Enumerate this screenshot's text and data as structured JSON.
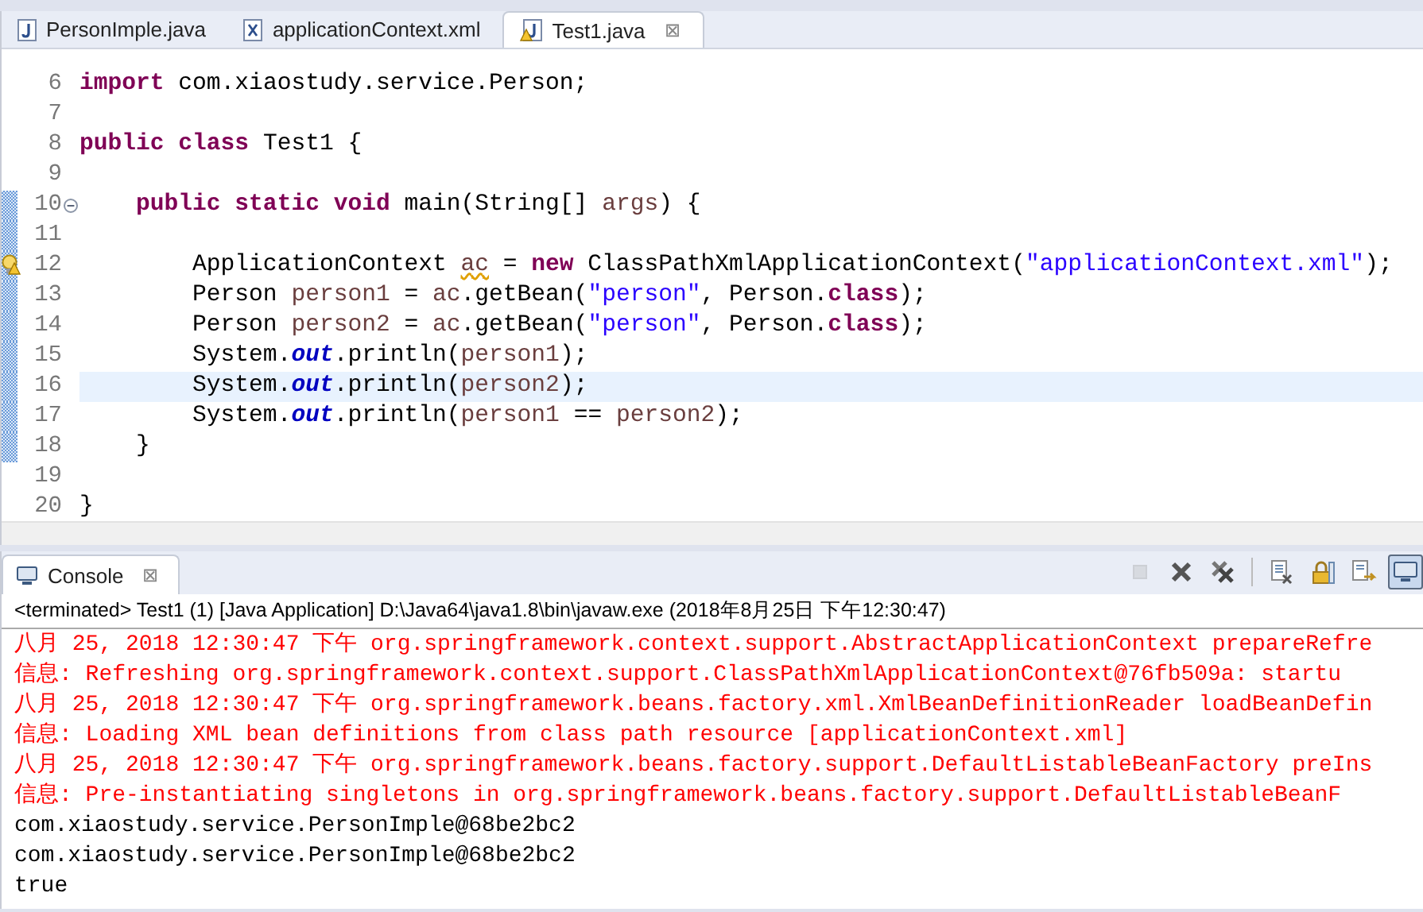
{
  "editor_tabs": [
    {
      "label": "PersonImple.java",
      "kind": "java",
      "selected": false,
      "warning": false
    },
    {
      "label": "applicationContext.xml",
      "kind": "xml",
      "selected": false,
      "warning": false
    },
    {
      "label": "Test1.java",
      "kind": "java",
      "selected": true,
      "warning": true,
      "close": "⊠"
    }
  ],
  "code_lines": [
    {
      "number": "6",
      "changed": false,
      "current": false,
      "warning": false,
      "fold": false,
      "tokens": [
        {
          "kind": "keyword",
          "text": "import"
        },
        {
          "kind": "plain",
          "text": " com.xiaostudy.service.Person;"
        }
      ]
    },
    {
      "number": "7",
      "changed": false,
      "current": false,
      "warning": false,
      "fold": false
    },
    {
      "number": "8",
      "changed": false,
      "current": false,
      "warning": false,
      "fold": false,
      "tokens": [
        {
          "kind": "keyword",
          "text": "public class"
        },
        {
          "kind": "plain",
          "text": " Test1 {"
        }
      ]
    },
    {
      "number": "9",
      "changed": false,
      "current": false,
      "warning": false,
      "fold": false
    },
    {
      "number": "10",
      "changed": true,
      "current": false,
      "warning": false,
      "fold": true,
      "tokens": [
        {
          "kind": "keyword",
          "text": "    public static void"
        },
        {
          "kind": "plain",
          "text": " main(String[] "
        },
        {
          "kind": "local",
          "text": "args"
        },
        {
          "kind": "plain",
          "text": ") {"
        }
      ]
    },
    {
      "number": "11",
      "changed": true,
      "current": false,
      "warning": false,
      "fold": false
    },
    {
      "number": "12",
      "changed": true,
      "current": false,
      "warning": true,
      "fold": false,
      "tokens": [
        {
          "kind": "plain",
          "text": "        ApplicationContext "
        },
        {
          "kind": "flagged",
          "text": "ac"
        },
        {
          "kind": "plain",
          "text": " = "
        },
        {
          "kind": "keyword",
          "text": "new"
        },
        {
          "kind": "plain",
          "text": " ClassPathXmlApplicationContext("
        },
        {
          "kind": "string",
          "text": "\"applicationContext.xml\""
        },
        {
          "kind": "plain",
          "text": ");"
        }
      ]
    },
    {
      "number": "13",
      "changed": true,
      "current": false,
      "warning": false,
      "fold": false,
      "tokens": [
        {
          "kind": "plain",
          "text": "        Person "
        },
        {
          "kind": "local",
          "text": "person1"
        },
        {
          "kind": "plain",
          "text": " = "
        },
        {
          "kind": "local",
          "text": "ac"
        },
        {
          "kind": "plain",
          "text": ".getBean("
        },
        {
          "kind": "string",
          "text": "\"person\""
        },
        {
          "kind": "plain",
          "text": ", Person."
        },
        {
          "kind": "keyword",
          "text": "class"
        },
        {
          "kind": "plain",
          "text": ");"
        }
      ]
    },
    {
      "number": "14",
      "changed": true,
      "current": false,
      "warning": false,
      "fold": false,
      "tokens": [
        {
          "kind": "plain",
          "text": "        Person "
        },
        {
          "kind": "local",
          "text": "person2"
        },
        {
          "kind": "plain",
          "text": " = "
        },
        {
          "kind": "local",
          "text": "ac"
        },
        {
          "kind": "plain",
          "text": ".getBean("
        },
        {
          "kind": "string",
          "text": "\"person\""
        },
        {
          "kind": "plain",
          "text": ", Person."
        },
        {
          "kind": "keyword",
          "text": "class"
        },
        {
          "kind": "plain",
          "text": ");"
        }
      ]
    },
    {
      "number": "15",
      "changed": true,
      "current": false,
      "warning": false,
      "fold": false,
      "tokens": [
        {
          "kind": "plain",
          "text": "        System."
        },
        {
          "kind": "field",
          "text": "out"
        },
        {
          "kind": "plain",
          "text": ".println("
        },
        {
          "kind": "local",
          "text": "person1"
        },
        {
          "kind": "plain",
          "text": ");"
        }
      ]
    },
    {
      "number": "16",
      "changed": true,
      "current": true,
      "warning": false,
      "fold": false,
      "tokens": [
        {
          "kind": "plain",
          "text": "        System."
        },
        {
          "kind": "field",
          "text": "out"
        },
        {
          "kind": "plain",
          "text": ".println("
        },
        {
          "kind": "local",
          "text": "person2"
        },
        {
          "kind": "plain",
          "text": ");"
        }
      ]
    },
    {
      "number": "17",
      "changed": true,
      "current": false,
      "warning": false,
      "fold": false,
      "tokens": [
        {
          "kind": "plain",
          "text": "        System."
        },
        {
          "kind": "field",
          "text": "out"
        },
        {
          "kind": "plain",
          "text": ".println("
        },
        {
          "kind": "local",
          "text": "person1"
        },
        {
          "kind": "plain",
          "text": " == "
        },
        {
          "kind": "local",
          "text": "person2"
        },
        {
          "kind": "plain",
          "text": ");"
        }
      ]
    },
    {
      "number": "18",
      "changed": true,
      "current": false,
      "warning": false,
      "fold": false,
      "tokens": [
        {
          "kind": "plain",
          "text": "    }"
        }
      ]
    },
    {
      "number": "19",
      "changed": false,
      "current": false,
      "warning": false,
      "fold": false
    },
    {
      "number": "20",
      "changed": false,
      "current": false,
      "warning": false,
      "fold": false,
      "tokens": [
        {
          "kind": "plain",
          "text": "}"
        }
      ]
    }
  ],
  "console": {
    "tab": {
      "label": "Console",
      "close": "⊠",
      "selected": true
    },
    "toolbar": [
      {
        "kind": "terminate",
        "disabled": true,
        "pressed": false
      },
      {
        "kind": "remove",
        "disabled": false,
        "pressed": false
      },
      {
        "kind": "remove-all",
        "disabled": false,
        "pressed": false
      },
      {
        "kind": "separator"
      },
      {
        "kind": "clear",
        "disabled": false,
        "pressed": false
      },
      {
        "kind": "lock",
        "disabled": false,
        "pressed": false
      },
      {
        "kind": "wrap",
        "disabled": false,
        "pressed": false
      },
      {
        "kind": "display",
        "disabled": false,
        "pressed": true
      }
    ],
    "header": "<terminated> Test1 (1) [Java Application] D:\\Java64\\java1.8\\bin\\javaw.exe (2018年8月25日 下午12:30:47)",
    "lines": [
      {
        "kind": "error",
        "text": "八月 25, 2018 12:30:47 下午 org.springframework.context.support.AbstractApplicationContext prepareRefre"
      },
      {
        "kind": "error",
        "text": "信息: Refreshing org.springframework.context.support.ClassPathXmlApplicationContext@76fb509a: startu"
      },
      {
        "kind": "error",
        "text": "八月 25, 2018 12:30:47 下午 org.springframework.beans.factory.xml.XmlBeanDefinitionReader loadBeanDefin"
      },
      {
        "kind": "error",
        "text": "信息: Loading XML bean definitions from class path resource [applicationContext.xml]"
      },
      {
        "kind": "error",
        "text": "八月 25, 2018 12:30:47 下午 org.springframework.beans.factory.support.DefaultListableBeanFactory preIns"
      },
      {
        "kind": "error",
        "text": "信息: Pre-instantiating singletons in org.springframework.beans.factory.support.DefaultListableBeanF"
      },
      {
        "kind": "output",
        "text": "com.xiaostudy.service.PersonImple@68be2bc2"
      },
      {
        "kind": "output",
        "text": "com.xiaostudy.service.PersonImple@68be2bc2"
      },
      {
        "kind": "output",
        "text": "true"
      }
    ]
  }
}
